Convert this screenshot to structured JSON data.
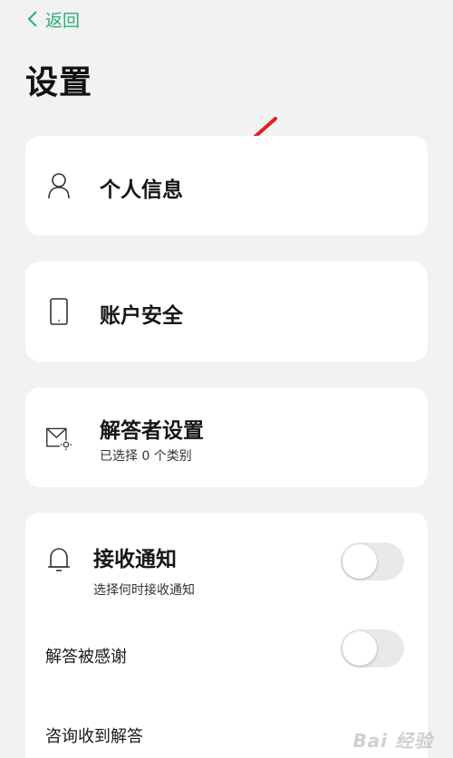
{
  "nav": {
    "back_label": "返回"
  },
  "page": {
    "title": "设置"
  },
  "items": {
    "personal_info": {
      "title": "个人信息",
      "icon": "person-icon"
    },
    "account_security": {
      "title": "账户安全",
      "icon": "phone-icon"
    },
    "answerer_settings": {
      "title": "解答者设置",
      "subtitle": "已选择 0 个类别",
      "icon": "mail-gear-icon"
    },
    "notifications": {
      "title": "接收通知",
      "subtitle": "选择何时接收通知",
      "icon": "bell-icon",
      "enabled": false,
      "options": [
        {
          "label": "解答被感谢",
          "enabled": false
        },
        {
          "label": "咨询收到解答",
          "enabled": false
        }
      ]
    }
  },
  "watermark": "Bai 经验",
  "colors": {
    "accent": "#2fae73",
    "background": "#f2f2f2",
    "card": "#ffffff",
    "annotation_arrow": "#e02020"
  }
}
